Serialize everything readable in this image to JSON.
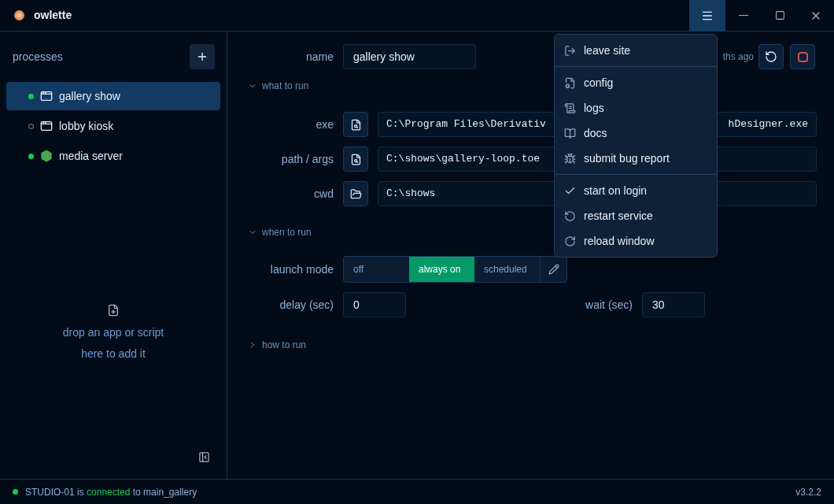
{
  "window": {
    "title": "owlette"
  },
  "sidebar": {
    "title": "processes",
    "items": [
      {
        "name": "gallery show",
        "running": true,
        "kind": "window",
        "selected": true
      },
      {
        "name": "lobby kiosk",
        "running": false,
        "kind": "window",
        "selected": false
      },
      {
        "name": "media server",
        "running": true,
        "kind": "package",
        "selected": false
      }
    ],
    "drop_hint": [
      "drop an app or script",
      "here to add it"
    ]
  },
  "editor": {
    "name_label": "name",
    "name_value": "gallery show",
    "modified": "ths ago",
    "sections": [
      {
        "title": "what to run",
        "expanded": true
      },
      {
        "title": "when to run",
        "expanded": true
      },
      {
        "title": "how to run",
        "expanded": false
      }
    ],
    "exe": {
      "label": "exe",
      "value_start": "C:\\Program Files\\Derivativ",
      "value_end": "hDesigner.exe"
    },
    "path": {
      "label": "path / args",
      "value": "C:\\shows\\gallery-loop.toe"
    },
    "cwd": {
      "label": "cwd",
      "value": "C:\\shows"
    },
    "launch_mode": {
      "label": "launch mode",
      "options": [
        {
          "label": "off",
          "selected": false
        },
        {
          "label": "always on",
          "selected": true
        },
        {
          "label": "scheduled",
          "selected": false
        }
      ]
    },
    "delay": {
      "label": "delay (sec)",
      "value": "0"
    },
    "wait": {
      "label": "wait (sec)",
      "value": "30"
    }
  },
  "menu": {
    "groups": [
      [
        {
          "label": "leave site",
          "kind": "action"
        }
      ],
      [
        {
          "label": "config",
          "kind": "action"
        },
        {
          "label": "logs",
          "kind": "action"
        },
        {
          "label": "docs",
          "kind": "action"
        },
        {
          "label": "submit bug report",
          "kind": "action"
        }
      ],
      [
        {
          "label": "start on login",
          "kind": "toggle",
          "checked": true
        },
        {
          "label": "restart service",
          "kind": "action"
        },
        {
          "label": "reload window",
          "kind": "action"
        }
      ]
    ]
  },
  "status_bar": {
    "machine": "STUDIO-01",
    "is": "is",
    "state": "connected",
    "to": "to main_gallery",
    "version": "v3.2.2"
  }
}
